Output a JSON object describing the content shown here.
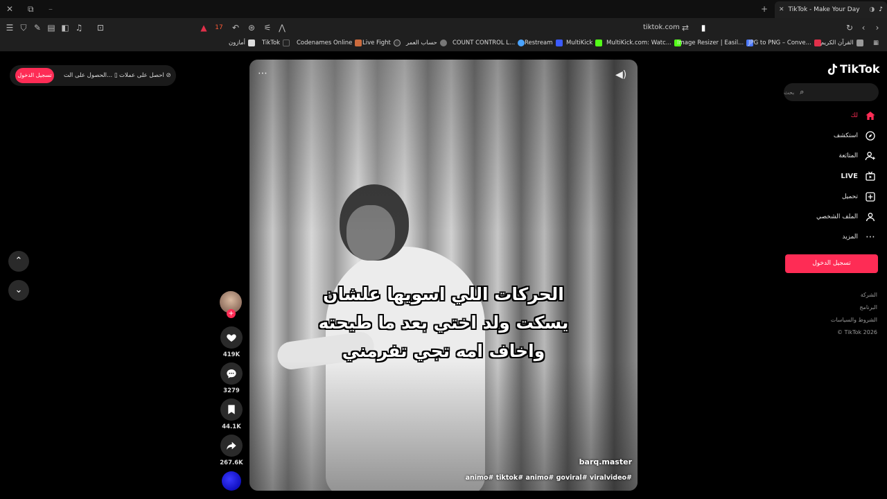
{
  "browser": {
    "tab_title": "TikTok - Make Your Day",
    "new_tab": "+",
    "url": "tiktok.com",
    "shield_count": "17"
  },
  "bookmarks": [
    {
      "label": "أمازون",
      "color": "#ffffff"
    },
    {
      "label": "TikTok",
      "color": "#ffffff"
    },
    {
      "label": "Codenames Online",
      "color": "#cc6b3d"
    },
    {
      "label": "Live Fight",
      "color": "#ffffff"
    },
    {
      "label": "حساب العمر",
      "color": "#8a8a8a"
    },
    {
      "label": "COUNT CONTROL L...",
      "color": "#4aa3ff"
    },
    {
      "label": "Restream",
      "color": "#3b5bff"
    },
    {
      "label": "MultiKick",
      "color": "#53fc18"
    },
    {
      "label": "MultiKick.com: Watc...",
      "color": "#53fc18"
    },
    {
      "label": "Image Resizer | Easil...",
      "color": "#4a78ff"
    },
    {
      "label": "JPG to PNG – Conve...",
      "color": "#e0304a"
    },
    {
      "label": "القرآن الكريم",
      "color": "#9a9a9a"
    }
  ],
  "top_left": {
    "login": "تسجيل الدخول",
    "get_app": "الحصول على الت...",
    "get_coins": "احصل على عملات"
  },
  "video": {
    "caption_line1": "الحركات اللي اسويها علشان",
    "caption_line2": "يسكت ولد اختي بعد ما طيحته",
    "caption_line3": "واخاف امه تجي تفرمني",
    "author": "barq.master",
    "hashtags": "animo# tiktok# animo# goviral# viralvideo#"
  },
  "actions": {
    "likes": "419K",
    "comments": "3279",
    "saves": "44.1K",
    "shares": "267.6K"
  },
  "sidebar": {
    "logo": "TikTok",
    "search_placeholder": "بحث",
    "nav": [
      {
        "label": "لك",
        "icon": "home-icon"
      },
      {
        "label": "استكشف",
        "icon": "compass-icon"
      },
      {
        "label": "المتابَعة",
        "icon": "person-plus-icon"
      },
      {
        "label": "LIVE",
        "icon": "live-tv-icon"
      },
      {
        "label": "تحميل",
        "icon": "upload-icon"
      },
      {
        "label": "الملف الشخصي",
        "icon": "profile-icon"
      },
      {
        "label": "المزيد",
        "icon": "more-icon"
      }
    ],
    "login": "تسجيل الدخول",
    "footer": [
      "الشركة",
      "البرنامج",
      "الشروط والسياسات",
      "© TikTok 2026"
    ]
  },
  "colors": {
    "accent": "#fe2c55",
    "background": "#000000"
  }
}
